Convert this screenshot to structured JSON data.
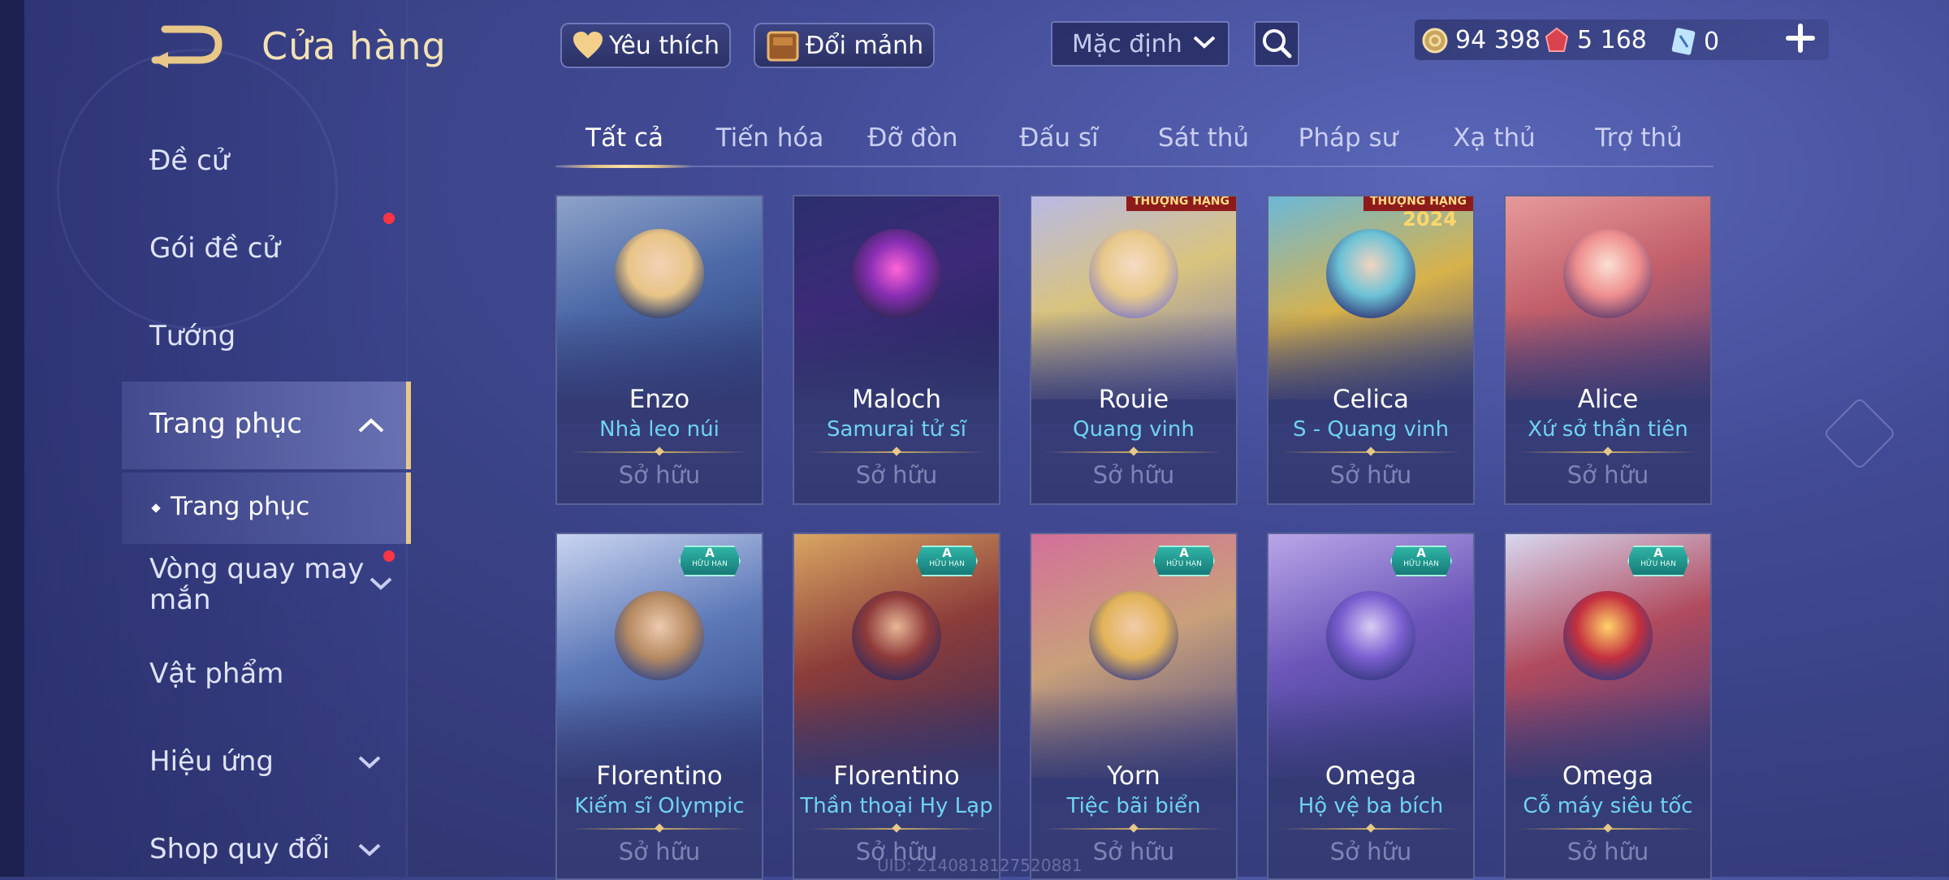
{
  "header": {
    "title": "Cửa hàng"
  },
  "sidebar": {
    "items": [
      {
        "label": "Đề cử"
      },
      {
        "label": "Gói đề cử"
      },
      {
        "label": "Tướng"
      },
      {
        "label": "Trang phục"
      },
      {
        "label": "Vòng quay may mắn"
      },
      {
        "label": "Vật phẩm"
      },
      {
        "label": "Hiệu ứng"
      },
      {
        "label": "Shop quy đổi"
      }
    ],
    "sub_item": "Trang phục"
  },
  "topbar": {
    "favorite_label": "Yêu thích",
    "exchange_label": "Đổi mảnh",
    "sort_value": "Mặc định",
    "gold": "94 398",
    "gems": "5 168",
    "vouchers": "0"
  },
  "tabs": [
    "Tất cả",
    "Tiến hóa",
    "Đỡ đòn",
    "Đấu sĩ",
    "Sát thủ",
    "Pháp sư",
    "Xạ thủ",
    "Trợ thủ"
  ],
  "cards": [
    {
      "hero": "Enzo",
      "skin": "Nhà leo núi",
      "status": "Sở hữu"
    },
    {
      "hero": "Maloch",
      "skin": "Samurai tử sĩ",
      "status": "Sở hữu"
    },
    {
      "hero": "Rouie",
      "skin": "Quang vinh",
      "status": "Sở hữu"
    },
    {
      "hero": "Celica",
      "skin": "S - Quang vinh",
      "status": "Sở hữu"
    },
    {
      "hero": "Alice",
      "skin": "Xứ sở thần tiên",
      "status": "Sở hữu"
    },
    {
      "hero": "Florentino",
      "skin": "Kiếm sĩ Olympic",
      "status": "Sở hữu",
      "badge": "A",
      "badge_sub": "HỮU HẠN"
    },
    {
      "hero": "Florentino",
      "skin": "Thần thoại Hy Lạp",
      "status": "Sở hữu",
      "badge": "A",
      "badge_sub": "HỮU HẠN"
    },
    {
      "hero": "Yorn",
      "skin": "Tiệc bãi biển",
      "status": "Sở hữu",
      "badge": "A",
      "badge_sub": "HỮU HẠN"
    },
    {
      "hero": "Omega",
      "skin": "Hộ vệ ba bích",
      "status": "Sở hữu",
      "badge": "A",
      "badge_sub": "HỮU HẠN"
    },
    {
      "hero": "Omega",
      "skin": "Cỗ máy siêu tốc",
      "status": "Sở hữu",
      "badge": "A",
      "badge_sub": "HỮU HẠN"
    }
  ],
  "rank_banners": {
    "rouie": "THƯỢNG HẠNG",
    "celica": "THƯỢNG HẠNG",
    "celica_year": "2024"
  },
  "uid": "UID: 2140818127520881",
  "colors": {
    "accent_gold": "#e7c889",
    "skin_name": "#6fd3f2",
    "notification": "#ff3545",
    "badge": "#2fb4a5"
  }
}
